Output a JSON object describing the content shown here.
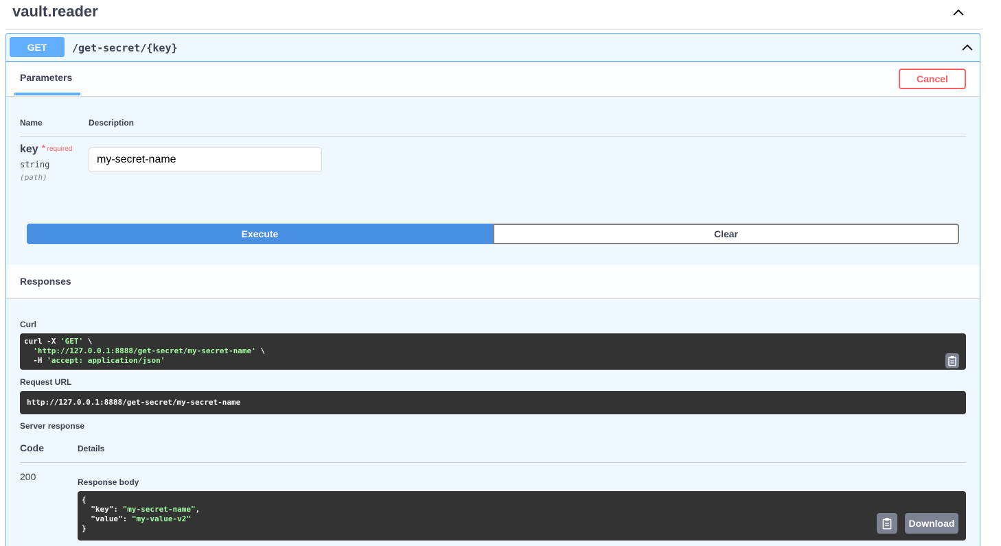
{
  "tag": {
    "title": "vault.reader"
  },
  "operation": {
    "method": "GET",
    "path": "/get-secret/{key}"
  },
  "parameters": {
    "tab_label": "Parameters",
    "cancel_label": "Cancel",
    "columns": {
      "name": "Name",
      "description": "Description"
    },
    "items": [
      {
        "name": "key",
        "required_star": "*",
        "required_label": "required",
        "type": "string",
        "in": "(path)",
        "value": "my-secret-name"
      }
    ],
    "execute_label": "Execute",
    "clear_label": "Clear"
  },
  "responses": {
    "title": "Responses",
    "curl_label": "Curl",
    "curl": {
      "l1_cmd": "curl -X ",
      "l1_method": "'GET'",
      "l1_tail": " \\",
      "l2_indent": "  ",
      "l2_url": "'http://127.0.0.1:8888/get-secret/my-secret-name'",
      "l2_tail": " \\",
      "l3_cmd": "  -H ",
      "l3_header": "'accept: application/json'"
    },
    "request_url_label": "Request URL",
    "request_url": "http://127.0.0.1:8888/get-secret/my-secret-name",
    "server_response_label": "Server response",
    "code_col": "Code",
    "details_col": "Details",
    "code": "200",
    "body_label": "Response body",
    "body": {
      "open": "{",
      "k1": "\"key\"",
      "v1": "\"my-secret-name\"",
      "k2": "\"value\"",
      "v2": "\"my-value-v2\"",
      "close": "}"
    },
    "download_label": "Download"
  },
  "icons": {
    "collapse": "chevron-up-icon",
    "copy": "clipboard-icon"
  },
  "colors": {
    "get": "#61affe",
    "cancel": "#ff6060",
    "execute": "#4990e2",
    "code_bg": "#333333",
    "string": "#a2fca2"
  }
}
